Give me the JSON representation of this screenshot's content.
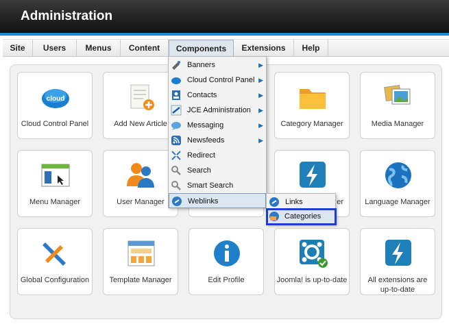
{
  "app": {
    "title": "Administration"
  },
  "menu": [
    {
      "label": "Site"
    },
    {
      "label": "Users"
    },
    {
      "label": "Menus"
    },
    {
      "label": "Content"
    },
    {
      "label": "Components"
    },
    {
      "label": "Extensions"
    },
    {
      "label": "Help"
    }
  ],
  "tiles": [
    {
      "label": "Cloud Control Panel",
      "icon": "cloud-icon"
    },
    {
      "label": "Add New Article",
      "icon": "add-article-icon"
    },
    {
      "label": "",
      "icon": "hidden-tile"
    },
    {
      "label": "Category Manager",
      "icon": "folder-icon"
    },
    {
      "label": "Media Manager",
      "icon": "media-icon"
    },
    {
      "label": "Menu Manager",
      "icon": "menu-icon"
    },
    {
      "label": "User Manager",
      "icon": "users-icon"
    },
    {
      "label": "",
      "icon": "hidden-tile"
    },
    {
      "label": "er",
      "icon": "flash-icon"
    },
    {
      "label": "Language Manager",
      "icon": "globe-icon"
    },
    {
      "label": "Global Configuration",
      "icon": "tools-icon"
    },
    {
      "label": "Template Manager",
      "icon": "template-icon"
    },
    {
      "label": "Edit Profile",
      "icon": "info-icon"
    },
    {
      "label": "Joomla! is up-to-date",
      "icon": "joomla-icon"
    },
    {
      "label": "All extensions are up-to-date",
      "icon": "flash-icon"
    }
  ],
  "components_menu": [
    {
      "label": "Banners",
      "icon": "banners-icon",
      "submenu": true
    },
    {
      "label": "Cloud Control Panel",
      "icon": "cloud-icon",
      "submenu": true
    },
    {
      "label": "Contacts",
      "icon": "contacts-icon",
      "submenu": true
    },
    {
      "label": "JCE Administration",
      "icon": "jce-icon",
      "submenu": true
    },
    {
      "label": "Messaging",
      "icon": "messaging-icon",
      "submenu": true
    },
    {
      "label": "Newsfeeds",
      "icon": "rss-icon",
      "submenu": true
    },
    {
      "label": "Redirect",
      "icon": "redirect-icon",
      "submenu": false
    },
    {
      "label": "Search",
      "icon": "search-icon",
      "submenu": false
    },
    {
      "label": "Smart Search",
      "icon": "search-icon",
      "submenu": false
    },
    {
      "label": "Weblinks",
      "icon": "weblinks-icon",
      "submenu": false
    }
  ],
  "weblinks_submenu": [
    {
      "label": "Links",
      "icon": "weblinks-icon"
    },
    {
      "label": "Categories",
      "icon": "category-icon"
    }
  ],
  "colors": {
    "accent": "#1a8fc9",
    "highlight": "#1c3fd1"
  }
}
